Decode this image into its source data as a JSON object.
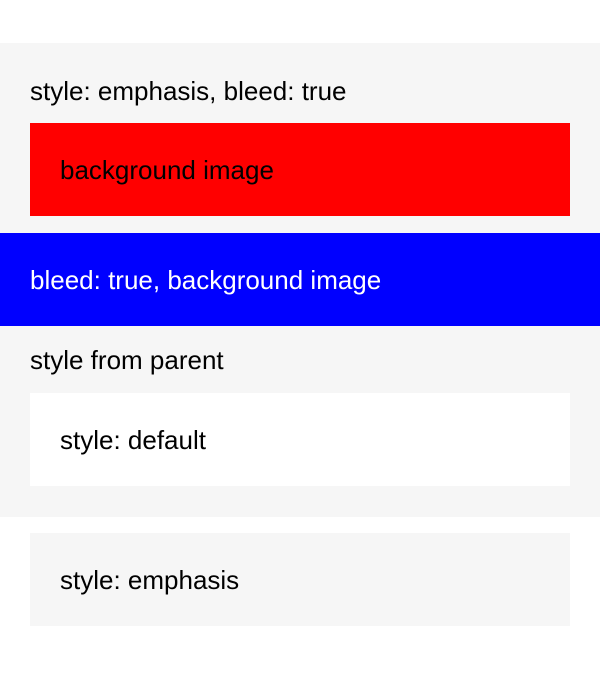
{
  "container": {
    "label": "style: emphasis, bleed: true",
    "background": "#f6f6f6"
  },
  "red_card": {
    "label": "background image",
    "background": "#ff0000"
  },
  "blue_band": {
    "label": "bleed: true, background image",
    "background": "#0000ff"
  },
  "parent_style": {
    "label": "style from parent"
  },
  "default_card": {
    "label": "style: default",
    "background": "#ffffff"
  },
  "emphasis_card": {
    "label": "style: emphasis",
    "background": "#f6f6f6"
  }
}
